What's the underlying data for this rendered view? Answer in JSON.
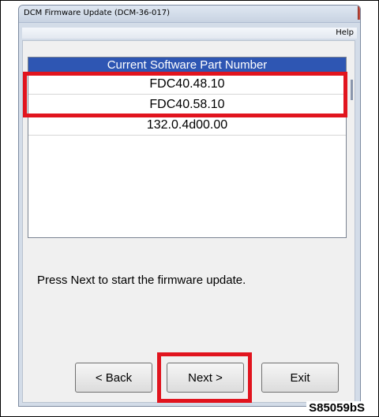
{
  "window": {
    "title": "DCM Firmware Update (DCM-36-017)"
  },
  "menu": {
    "help": "Help"
  },
  "part_list": {
    "header": "Current Software Part Number",
    "rows": [
      "FDC40.48.10",
      "FDC40.58.10",
      "132.0.4d00.00"
    ]
  },
  "message": "Press Next to start the firmware update.",
  "buttons": {
    "back": "< Back",
    "next": "Next >",
    "exit": "Exit"
  },
  "figure_code": "S85059bS",
  "colors": {
    "highlight": "#e1141e",
    "list_header": "#2e56b3"
  }
}
